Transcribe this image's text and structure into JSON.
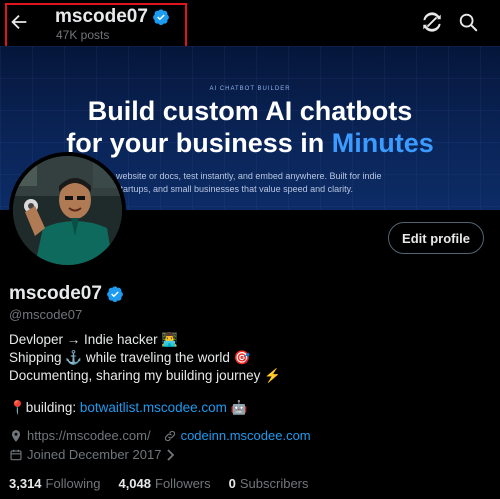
{
  "header": {
    "name": "mscode07",
    "posts": "47K posts"
  },
  "banner": {
    "tag": "AI CHATBOT BUILDER",
    "headline_line1": "Build custom AI chatbots",
    "headline_line2_prefix": "for your business in ",
    "headline_line2_accent": "Minutes",
    "sub_line1": "website or docs, test instantly, and embed anywhere. Built for indie",
    "sub_line2": "startups, and small businesses that value speed and clarity.",
    "accent_color": "#3b9bff"
  },
  "profile": {
    "edit_label": "Edit profile",
    "display_name": "mscode07",
    "handle": "@mscode07",
    "bio_line1": "Devloper → Indie hacker 👨‍💻",
    "bio_line2": "Shipping ⚓ while traveling the world 🎯",
    "bio_line3": "Documenting, sharing my building journey ⚡",
    "building_prefix": "📍building: ",
    "building_link": "botwaitlist.mscodee.com",
    "building_suffix": " 🤖",
    "website": "https://mscodee.com/",
    "link2": "codeinn.mscodee.com",
    "joined": "Joined December 2017"
  },
  "stats": {
    "following_count": "3,314",
    "following_label": "Following",
    "followers_count": "4,048",
    "followers_label": "Followers",
    "subscribers_count": "0",
    "subscribers_label": "Subscribers"
  },
  "icons": {
    "back": "arrow-left-icon",
    "refresh": "refresh-icon",
    "search": "search-icon",
    "verified": "verified-badge-icon",
    "location": "location-pin-icon",
    "link": "link-icon",
    "calendar": "calendar-icon"
  },
  "colors": {
    "verified": "#1d9bf0",
    "link": "#1d9bf0",
    "highlight_border": "#e0141e"
  }
}
